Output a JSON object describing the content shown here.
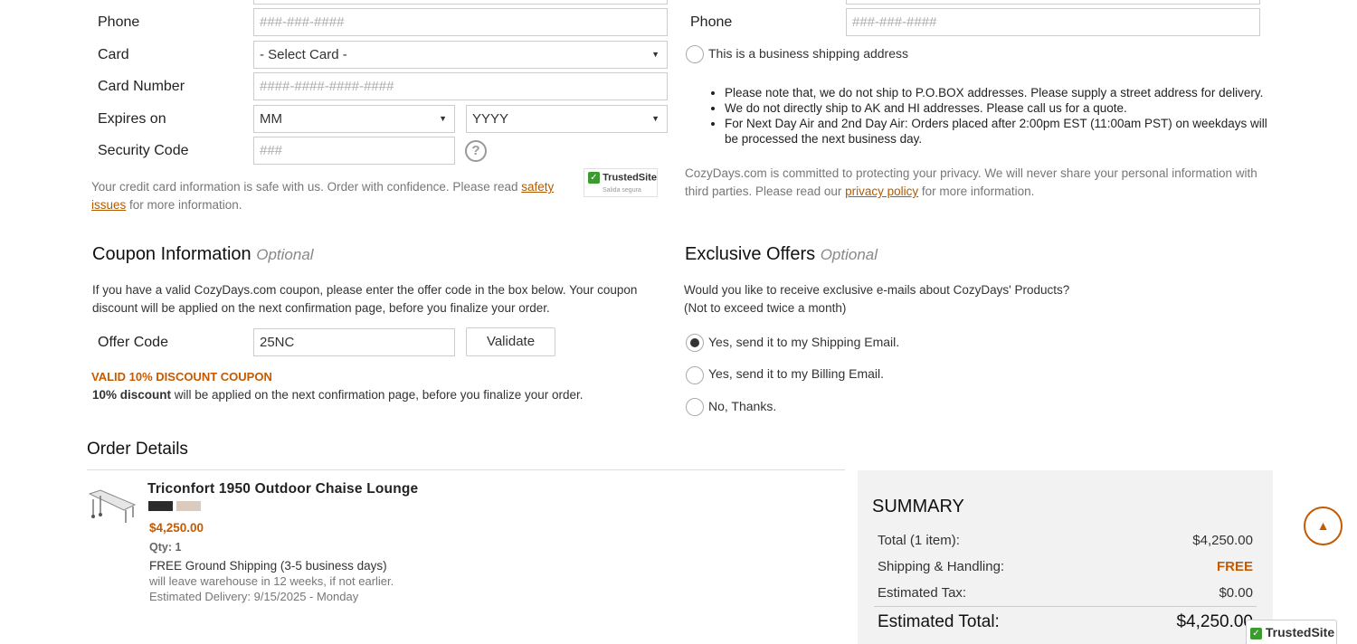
{
  "billing": {
    "phone_label": "Phone",
    "phone_placeholder": "###-###-####",
    "card_label": "Card",
    "card_value": "- Select Card -",
    "card_number_label": "Card Number",
    "card_number_placeholder": "####-####-####-####",
    "expires_label": "Expires on",
    "month_value": "MM",
    "year_value": "YYYY",
    "security_label": "Security Code",
    "security_placeholder": "###",
    "help_icon": "?",
    "safe_text_1": "Your credit card information is safe with us. Order with confidence. Please read ",
    "safe_link_1": "safety",
    "safe_link_2": "issues",
    "safe_text_2": " for more information.",
    "trusted_badge": "TrustedSite",
    "trusted_sub": "Salida segura"
  },
  "shipping": {
    "phone_label": "Phone",
    "phone_placeholder": "###-###-####",
    "business_label": "This is a business shipping address",
    "notes": [
      "Please note that, we do not ship to P.O.BOX addresses. Please supply a street address for delivery.",
      "We do not directly ship to AK and HI addresses. Please call us for a quote.",
      "For Next Day Air and 2nd Day Air: Orders placed after 2:00pm EST (11:00am PST) on weekdays will be processed the next business day."
    ],
    "privacy_text_1": "CozyDays.com is committed to protecting your privacy. We will never share your personal information with third parties. Please read our ",
    "privacy_link": "privacy policy",
    "privacy_text_2": " for more information."
  },
  "coupon": {
    "title": "Coupon Information",
    "optional": "Optional",
    "desc": "If you have a valid CozyDays.com coupon, please enter the offer code in the box below. Your coupon discount will be applied on the next confirmation page, before you finalize your order.",
    "offer_label": "Offer Code",
    "offer_value": "25NC",
    "validate_label": "Validate",
    "valid_msg": "VALID 10% DISCOUNT COUPON",
    "discount_bold": "10% discount",
    "discount_rest": " will be applied on the next confirmation page, before you finalize your order."
  },
  "offers": {
    "title": "Exclusive Offers",
    "optional": "Optional",
    "desc_1": "Would you like to receive exclusive e-mails about CozyDays' Products?",
    "desc_2": "(Not to exceed twice a month)",
    "options": [
      "Yes, send it to my Shipping Email.",
      "Yes, send it to my Billing Email.",
      "No, Thanks."
    ],
    "selected": 0
  },
  "order": {
    "title": "Order Details",
    "product_name": "Triconfort 1950 Outdoor Chaise Lounge",
    "price": "$4,250.00",
    "qty": "Qty: 1",
    "shipping": "FREE Ground Shipping (3-5 business days)",
    "warehouse": "will leave warehouse in 12 weeks, if not earlier.",
    "delivery": "Estimated Delivery: 9/15/2025 - Monday",
    "swatch_colors": [
      "#2b2b2b",
      "#d9cbbd"
    ]
  },
  "summary": {
    "title": "SUMMARY",
    "total_label": "Total (1 item):",
    "total_value": "$4,250.00",
    "shipping_label": "Shipping & Handling:",
    "shipping_value": "FREE",
    "tax_label": "Estimated Tax:",
    "tax_value": "$0.00",
    "est_total_label": "Estimated Total:",
    "est_total_value": "$4,250.00"
  },
  "floating": {
    "scroll_top_icon": "▲",
    "trusted_badge": "TrustedSite"
  },
  "colors": {
    "accent": "#c55a00",
    "trusted_green": "#3c9b2e"
  }
}
